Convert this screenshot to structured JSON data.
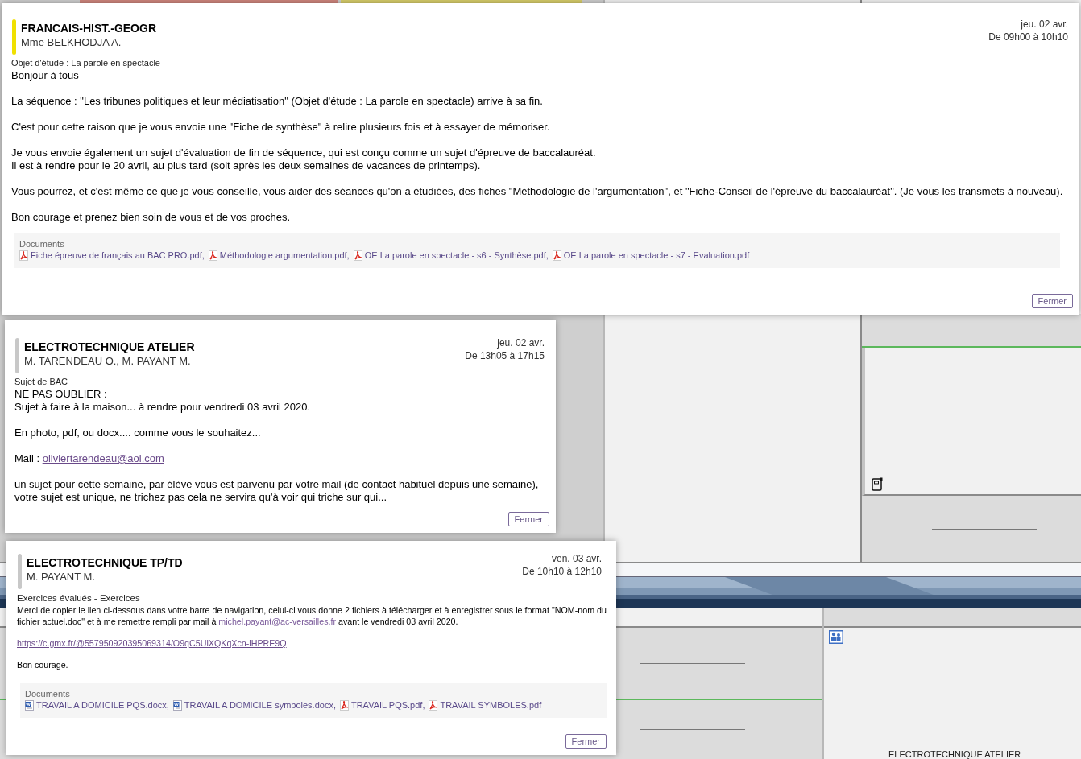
{
  "popups": [
    {
      "subject": "FRANCAIS-HIST.-GEOGR",
      "teachers": "Mme BELKHODJA A.",
      "color": "#f0e000",
      "date": "jeu. 02 avr.",
      "time": "De 09h00 à 10h10",
      "category": "Objet d'étude : La parole en spectacle",
      "kind": "standard",
      "body": [
        [
          [
            {
              "kind": "text",
              "text": "Bonjour à tous"
            }
          ]
        ],
        [
          [
            {
              "kind": "text",
              "text": "La séquence : \"Les tribunes politiques et leur médiatisation\" (Objet d'étude : La parole en spectacle) arrive à sa fin."
            }
          ]
        ],
        [
          [
            {
              "kind": "text",
              "text": "C'est pour cette raison que je vous envoie une \"Fiche de synthèse\" à relire plusieurs fois et à essayer de mémoriser."
            }
          ]
        ],
        [
          [
            {
              "kind": "text",
              "text": "Je vous envoie également un sujet d'évaluation de fin de séquence, qui est conçu comme un sujet d'épreuve de baccalauréat."
            }
          ],
          [
            {
              "kind": "text",
              "text": "Il est à rendre pour le 20 avril, au plus tard (soit après les deux semaines de vacances de printemps)."
            }
          ]
        ],
        [
          [
            {
              "kind": "text",
              "text": "Vous pourrez, et c'est même ce que je vous conseille, vous aider des séances qu'on a étudiées, des fiches \"Méthodologie de l'argumentation\", et \"Fiche-Conseil de l'épreuve du baccalauréat\". (Je vous les transmets à nouveau)."
            }
          ]
        ],
        [
          [
            {
              "kind": "text",
              "text": "Bon courage et prenez bien soin de vous et de vos proches."
            }
          ]
        ]
      ],
      "documents": {
        "label": "Documents",
        "files": [
          {
            "name": "Fiche épreuve de français au BAC PRO.pdf,",
            "kind": "pdf"
          },
          {
            "name": "Méthodologie argumentation.pdf,",
            "kind": "pdf"
          },
          {
            "name": "OE La parole en spectacle - s6 - Synthèse.pdf,",
            "kind": "pdf"
          },
          {
            "name": "OE La parole en spectacle - s7 - Evaluation.pdf",
            "kind": "pdf"
          }
        ]
      },
      "close": "Fermer"
    },
    {
      "subject": "ELECTROTECHNIQUE ATELIER",
      "teachers": "M. TARENDEAU O., M. PAYANT M.",
      "color": "#c8c8c8",
      "date": "jeu. 02 avr.",
      "time": "De 13h05 à 17h15",
      "category": "Sujet de BAC",
      "kind": "standard",
      "body": [
        [
          [
            {
              "kind": "text",
              "text": "NE PAS OUBLIER :"
            }
          ],
          [
            {
              "kind": "text",
              "text": "Sujet à faire à la maison... à rendre pour vendredi 03 avril 2020."
            }
          ]
        ],
        [
          [
            {
              "kind": "text",
              "text": "En photo, pdf, ou docx.... comme vous le souhaitez..."
            }
          ]
        ],
        [
          [
            {
              "kind": "text",
              "text": "Mail : "
            },
            {
              "kind": "link",
              "text": "oliviertarendeau@aol.com"
            }
          ]
        ],
        [
          [
            {
              "kind": "text",
              "text": "un sujet pour cette semaine, par élève vous est parvenu par votre mail (de contact habituel depuis une semaine),"
            }
          ],
          [
            {
              "kind": "text",
              "text": "votre sujet est unique, ne trichez pas cela ne servira qu'à voir qui triche sur qui..."
            }
          ]
        ]
      ],
      "close": "Fermer"
    },
    {
      "subject": "ELECTROTECHNIQUE TP/TD",
      "teachers": "M. PAYANT M.",
      "color": "#c8c8c8",
      "date": "ven. 03 avr.",
      "time": "De 10h10 à 12h10",
      "category": "Exercices évalués - Exercices",
      "kind": "compact",
      "body": [
        [
          [
            {
              "kind": "text",
              "text": "Merci de copier le lien ci-dessous dans votre barre de navigation, celui-ci vous donne 2 fichiers à télécharger et à enregistrer sous le format \"NOM-nom du fichier actuel.doc\" et à me remettre rempli par mail à "
            },
            {
              "kind": "email",
              "text": "michel.payant@ac-versailles.fr"
            },
            {
              "kind": "text",
              "text": " avant le vendredi 03 avril 2020."
            }
          ]
        ],
        [
          [
            {
              "kind": "link",
              "text": "https://c.gmx.fr/@557950920395069314/O9qC5UiXQKqXcn-lHPRE9Q"
            }
          ]
        ],
        [
          [
            {
              "kind": "text",
              "text": "Bon courage."
            }
          ]
        ]
      ],
      "documents": {
        "label": "Documents",
        "files": [
          {
            "name": "TRAVAIL A DOMICILE PQS.docx,",
            "kind": "word"
          },
          {
            "name": "TRAVAIL A DOMICILE symboles.docx,",
            "kind": "word"
          },
          {
            "name": "TRAVAIL PQS.pdf,",
            "kind": "pdf"
          },
          {
            "name": "TRAVAIL SYMBOLES.pdf",
            "kind": "pdf"
          }
        ]
      },
      "close": "Fermer"
    }
  ],
  "background": {
    "course_label": "ELECTROTECHNIQUE ATELIER"
  }
}
